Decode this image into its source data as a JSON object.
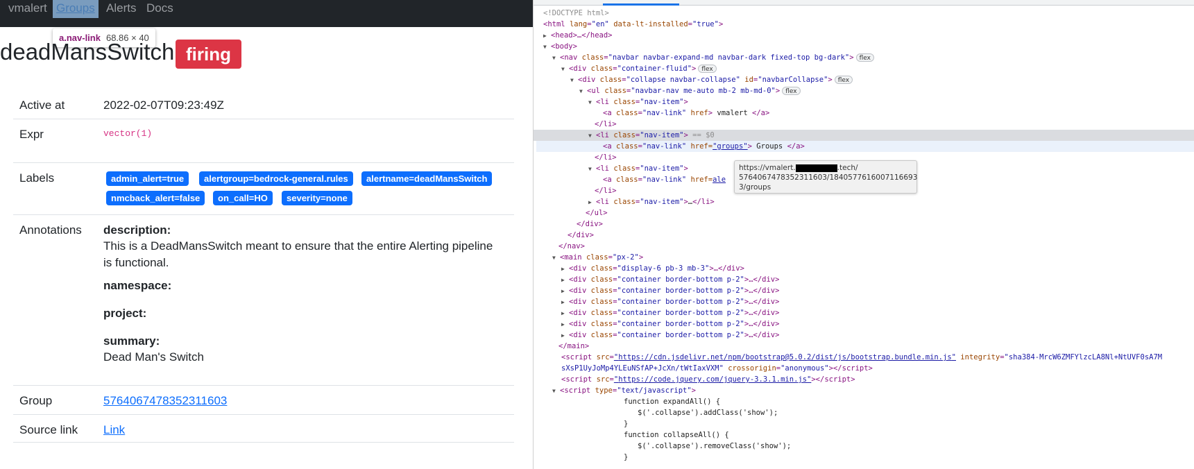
{
  "nav": {
    "brand": "vmalert",
    "items": [
      "Groups",
      "Alerts",
      "Docs"
    ],
    "tooltip_selector": "a.nav-link",
    "tooltip_dims": "68.86 × 40"
  },
  "alert": {
    "name": "deadMansSwitch",
    "state": "firing",
    "active_at_label": "Active at",
    "active_at": "2022-02-07T09:23:49Z",
    "expr_label": "Expr",
    "expr": "vector(1)",
    "labels_label": "Labels",
    "labels": [
      "admin_alert=true",
      "alertgroup=bedrock-general.rules",
      "alertname=deadMansSwitch",
      "nmcback_alert=false",
      "on_call=HO",
      "severity=none"
    ],
    "annotations_label": "Annotations",
    "annotations": [
      {
        "key": "description:",
        "value": "This is a DeadMansSwitch meant to ensure that the entire Alerting pipeline is functional."
      },
      {
        "key": "namespace:",
        "value": ""
      },
      {
        "key": "project:",
        "value": ""
      },
      {
        "key": "summary:",
        "value": "Dead Man's Switch"
      }
    ],
    "group_label": "Group",
    "group": "5764067478352311603",
    "source_label": "Source link",
    "source_link": "Link"
  },
  "devtools": {
    "doctype": "<!DOCTYPE html>",
    "html_open": [
      "html",
      "lang",
      "\"en\"",
      "data-lt-installed",
      "\"true\""
    ],
    "head": "<head>…</head>",
    "body": "<body>",
    "nav_open": [
      "nav",
      "class",
      "\"navbar navbar-expand-md navbar-dark fixed-top bg-dark\""
    ],
    "div_fluid": [
      "div",
      "class",
      "\"container-fluid\""
    ],
    "div_collapse": [
      "div",
      "class",
      "\"collapse navbar-collapse\"",
      "id",
      "\"navbarCollapse\""
    ],
    "ul_open": [
      "ul",
      "class",
      "\"navbar-nav me-auto mb-2 mb-md-0\""
    ],
    "li_open": [
      "li",
      "class",
      "\"nav-item\""
    ],
    "a_vmalert": [
      "a",
      "class",
      "\"nav-link\"",
      "href",
      " vmalert "
    ],
    "li_close": "</li>",
    "li_selected_suffix": " == $0",
    "a_groups": [
      "a",
      "class",
      "\"nav-link\"",
      "href=",
      "\"groups\"",
      " Groups "
    ],
    "a_alerts_partial": [
      "a",
      "class",
      "\"nav-link\"",
      "href=",
      "ale"
    ],
    "li_collapsed": "…",
    "ul_close": "</ul>",
    "div_close": "</div>",
    "nav_close": "</nav>",
    "main_open": [
      "main",
      "class",
      "\"px-2\""
    ],
    "main_children": [
      "\"display-6 pb-3 mb-3\"",
      "\"container border-bottom p-2\"",
      "\"container border-bottom p-2\"",
      "\"container border-bottom p-2\"",
      "\"container border-bottom p-2\"",
      "\"container border-bottom p-2\"",
      "\"container border-bottom p-2\""
    ],
    "main_close": "</main>",
    "script1_src": "https://cdn.jsdelivr.net/npm/bootstrap@5.0.2/dist/js/bootstrap.bundle.min.js",
    "script1_integrity": "\"sha384-MrcW6ZMFYlzcLA8Nl+NtUVF0sA7M",
    "script1_integrity2": "sXsP1UyJoMp4YLEuNSfAP+JcXn/tWtIaxVXM\"",
    "script1_crossorigin": "\"anonymous\"",
    "script2_src": "https://code.jquery.com/jquery-3.3.1.min.js",
    "script3_type": "\"text/javascript\"",
    "js_lines": [
      "function expandAll() {",
      "$('.collapse').addClass('show');",
      "}",
      "function collapseAll() {",
      "$('.collapse').removeClass('show');",
      "}"
    ],
    "flex_pill": "flex",
    "tooltip_url_1a": "https://vmalert.",
    "tooltip_url_1b": ".tech/",
    "tooltip_url_2": "5764067478352311603/1840577616007116693",
    "tooltip_url_3": "3/groups"
  },
  "colors": {
    "navbar_bg": "#212529",
    "firing_red": "#dc3545",
    "label_blue": "#0d6efd",
    "link_blue": "#0d6efd"
  }
}
